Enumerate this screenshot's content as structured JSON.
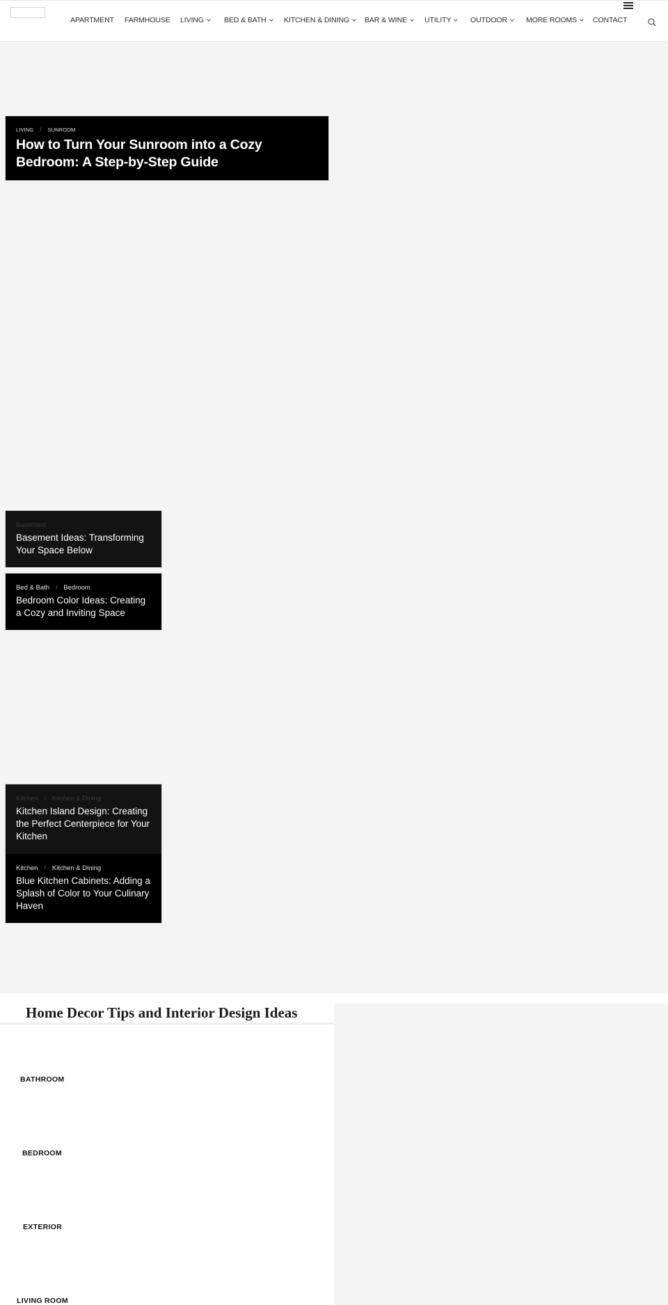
{
  "header": {
    "logo_alt": "",
    "nav": [
      {
        "label": "APARTMENT",
        "has_dropdown": false
      },
      {
        "label": "FARMHOUSE",
        "has_dropdown": false
      },
      {
        "label": "LIVING",
        "has_dropdown": true
      },
      {
        "label": "BED & BATH",
        "has_dropdown": true
      },
      {
        "label": "KITCHEN & DINING",
        "has_dropdown": true
      },
      {
        "label": "BAR & WINE",
        "has_dropdown": true
      },
      {
        "label": "UTILITY",
        "has_dropdown": true
      },
      {
        "label": "OUTDOOR",
        "has_dropdown": true
      },
      {
        "label": "MORE ROOMS",
        "has_dropdown": true
      },
      {
        "label": "CONTACT",
        "has_dropdown": false
      }
    ],
    "icons": {
      "menu": "hamburger-icon",
      "search": "search-icon"
    }
  },
  "featured": {
    "categories": [
      "LIVING",
      "SUNROOM"
    ],
    "separator": "/",
    "title": "How to Turn Your Sunroom into a Cozy Bedroom: A Step-by-Step Guide"
  },
  "posts": [
    {
      "categories": [
        "Basement"
      ],
      "title": "Basement Ideas: Transforming Your Space Below"
    },
    {
      "categories": [
        "Bed & Bath",
        "Bedroom"
      ],
      "title": "Bedroom Color Ideas: Creating a Cozy and Inviting Space"
    },
    {
      "categories": [
        "Kitchen",
        "Kitchen & Dining"
      ],
      "title": "Kitchen Island Design: Creating the Perfect Centerpiece for Your Kitchen"
    },
    {
      "categories": [
        "Kitchen",
        "Kitchen & Dining"
      ],
      "title": "Blue Kitchen Cabinets: Adding a Splash of Color to Your Culinary Haven"
    }
  ],
  "section": {
    "title": "Home Decor Tips and Interior Design Ideas",
    "categories": [
      "BATHROOM",
      "BEDROOM",
      "EXTERIOR",
      "LIVING ROOM"
    ]
  },
  "colors": {
    "page_bg": "#f4f4f4",
    "card_bg": "#000000",
    "card_bg_dim": "#131313",
    "text_light": "#ffffff"
  }
}
